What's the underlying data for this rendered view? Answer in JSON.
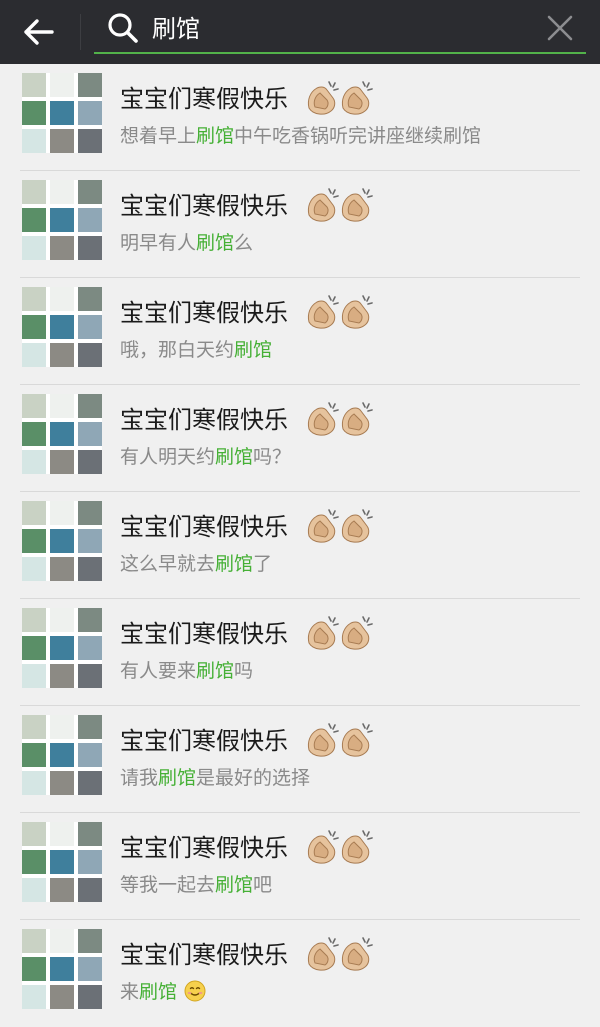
{
  "search": {
    "query": "刷馆"
  },
  "results": [
    {
      "title": "宝宝们寒假快乐",
      "before": "想着早上",
      "match": "刷馆",
      "after": "中午吃香锅听完讲座继续刷馆"
    },
    {
      "title": "宝宝们寒假快乐",
      "before": "明早有人",
      "match": "刷馆",
      "after": "么"
    },
    {
      "title": "宝宝们寒假快乐",
      "before": "哦，那白天约",
      "match": "刷馆",
      "after": ""
    },
    {
      "title": "宝宝们寒假快乐",
      "before": "有人明天约",
      "match": "刷馆",
      "after": "吗？"
    },
    {
      "title": "宝宝们寒假快乐",
      "before": "这么早就去",
      "match": "刷馆",
      "after": "了"
    },
    {
      "title": "宝宝们寒假快乐",
      "before": "有人要来",
      "match": "刷馆",
      "after": "吗"
    },
    {
      "title": "宝宝们寒假快乐",
      "before": "请我",
      "match": "刷馆",
      "after": "是最好的选择"
    },
    {
      "title": "宝宝们寒假快乐",
      "before": "等我一起去",
      "match": "刷馆",
      "after": "吧"
    },
    {
      "title": "宝宝们寒假快乐",
      "before": "来",
      "match": "刷馆",
      "after": ""
    }
  ],
  "icons": {
    "back": "back-arrow-icon",
    "search": "search-icon",
    "clear": "clear-icon",
    "title_emoji": "clapping-hands-icon",
    "last_emoji": "smile-icon",
    "avatar": "group-avatar-icon"
  },
  "colors": {
    "topbar": "#2b2c30",
    "accent": "#45b035",
    "background": "#f0f0f0"
  }
}
